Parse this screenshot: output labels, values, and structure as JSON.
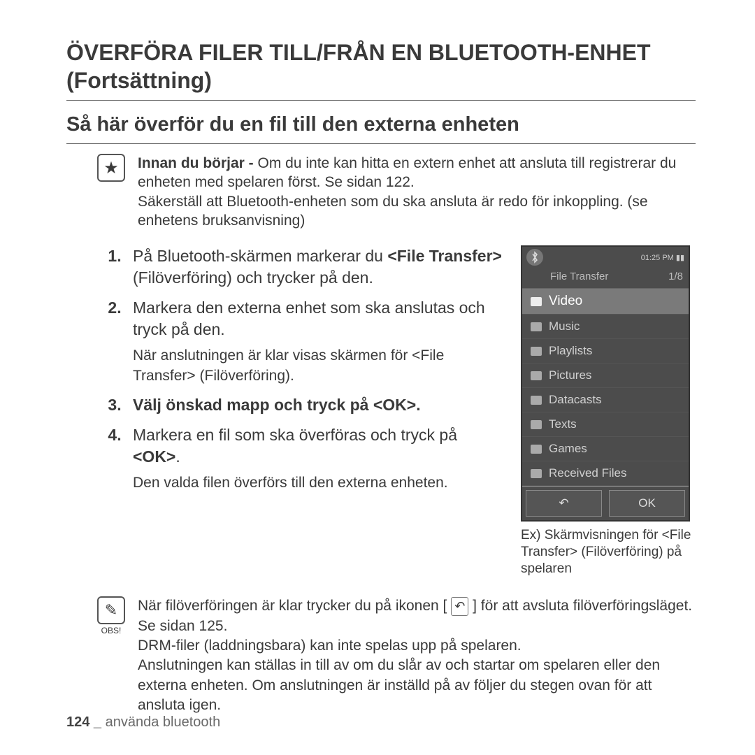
{
  "title": "ÖVERFÖRA FILER TILL/FRÅN EN BLUETOOTH-ENHET (Fortsättning)",
  "subtitle": "Så här överför du en ﬁl till den externa enheten",
  "intro": {
    "bold": "Innan du börjar - ",
    "line1a": "Om du inte kan hitta en extern enhet att ansluta till registrerar du enheten med spelaren först. Se sidan 122.",
    "line2": "Säkerställ att Bluetooth-enheten som du ska ansluta är redo för inkoppling. (se enhetens bruksanvisning)"
  },
  "steps": {
    "s1a": "På Bluetooth-skärmen markerar du ",
    "s1b": "<File Transfer>",
    "s1c": " (Filöverföring) och trycker på den.",
    "s2": "Markera den externa enhet som ska anslutas och tryck på den.",
    "s2note": "När anslutningen är klar visas skärmen för <File Transfer> (Filöverföring).",
    "s3": "Välj önskad mapp och tryck på <OK>.",
    "s4a": "Markera en ﬁl som ska överföras och tryck på ",
    "s4b": "<OK>",
    "s4c": ".",
    "s4note": "Den valda ﬁlen överförs till den externa enheten."
  },
  "phone": {
    "time": "01:25 PM",
    "header": "File Transfer",
    "pager": "1/8",
    "items": [
      "Video",
      "Music",
      "Playlists",
      "Pictures",
      "Datacasts",
      "Texts",
      "Games",
      "Received Files"
    ],
    "ok": "OK",
    "caption": "Ex) Skärmvisningen för <File Transfer> (Filöverföring) på spelaren"
  },
  "obs": {
    "label": "OBS!",
    "p1a": "När ﬁlöverföringen är klar trycker du på ikonen [ ",
    "p1b": " ] för att avsluta ﬁlöverföringsläget. Se sidan 125.",
    "p2": "DRM-ﬁler (laddningsbara) kan inte spelas upp på spelaren.",
    "p3": "Anslutningen kan ställas in till av om du slår av och startar om spelaren eller den externa enheten. Om anslutningen är inställd på av följer du stegen ovan för att ansluta igen."
  },
  "footer": {
    "page": "124 _",
    "section": " använda bluetooth"
  }
}
